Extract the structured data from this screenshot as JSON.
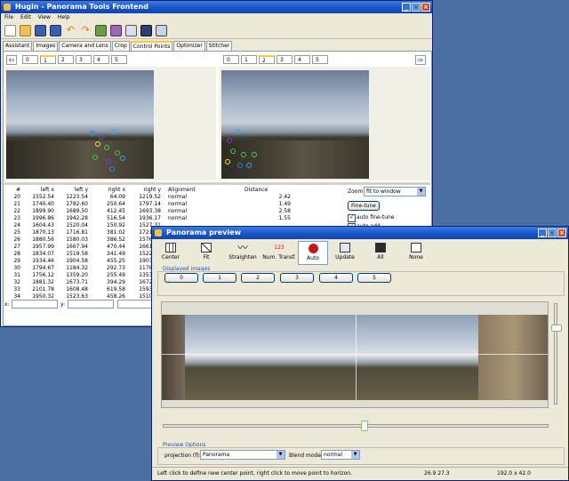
{
  "main_window": {
    "title": "Hugin - Panorama Tools Frontend",
    "menu": [
      "File",
      "Edit",
      "View",
      "Help"
    ],
    "tabs": [
      "Assistant",
      "Images",
      "Camera and Lens",
      "Crop",
      "Control Points",
      "Optimizer",
      "Stitcher"
    ],
    "active_tab": 4,
    "left_image_tabs": [
      "0",
      "1",
      "2",
      "3",
      "4",
      "5"
    ],
    "left_active_image": 1,
    "right_image_tabs": [
      "0",
      "1",
      "2",
      "3",
      "4",
      "5"
    ],
    "right_active_image": 2,
    "table": {
      "columns": [
        "#",
        "left x",
        "left y",
        "right x",
        "right y",
        "Alignment",
        "Distance"
      ],
      "rows": [
        [
          "20",
          "1552.54",
          "1223.54",
          "64.09",
          "1219.52",
          "normal",
          "2.42"
        ],
        [
          "21",
          "1740.40",
          "1782.60",
          "250.64",
          "1797.14",
          "normal",
          "1.49"
        ],
        [
          "22",
          "1899.90",
          "1689.50",
          "412.45",
          "1693.38",
          "normal",
          "2.58"
        ],
        [
          "23",
          "1996.86",
          "1942.28",
          "516.54",
          "1936.17",
          "normal",
          "1.55"
        ],
        [
          "24",
          "1604.43",
          "1520.04",
          "150.92",
          "1527.31",
          "",
          ""
        ],
        [
          "25",
          "1870.13",
          "1716.81",
          "381.02",
          "1721.72",
          "",
          ""
        ],
        [
          "26",
          "1880.56",
          "1580.03",
          "386.52",
          "1576.76",
          "",
          ""
        ],
        [
          "27",
          "1957.99",
          "1667.94",
          "470.44",
          "1661.54",
          "",
          ""
        ],
        [
          "28",
          "1834.07",
          "1519.58",
          "341.49",
          "1522.25",
          "",
          ""
        ],
        [
          "29",
          "1934.46",
          "1904.58",
          "455.25",
          "1903.96",
          "",
          ""
        ],
        [
          "30",
          "1794.67",
          "1184.32",
          "292.73",
          "1176.01",
          "",
          ""
        ],
        [
          "31",
          "1756.12",
          "1359.20",
          "255.49",
          "1353.62",
          "",
          ""
        ],
        [
          "32",
          "1881.32",
          "1673.71",
          "394.29",
          "1672.55",
          "",
          ""
        ],
        [
          "33",
          "2101.78",
          "1608.48",
          "619.58",
          "1593.37",
          "",
          ""
        ],
        [
          "34",
          "1950.32",
          "1523.63",
          "458.26",
          "1510.61",
          "",
          ""
        ]
      ]
    },
    "zoom_label": "Zoom:",
    "zoom_value": "fit to window",
    "fine_tune_label": "Fine-tune",
    "auto_fine_tune_label": "auto fine-tune",
    "auto_fine_tune_checked": true,
    "second_checkbox_label": "auto add",
    "coord_x_label": "x:",
    "coord_y_label": "y:"
  },
  "preview_window": {
    "title": "Panorama preview",
    "tools": [
      {
        "icon": "center-icon",
        "label": "Center"
      },
      {
        "icon": "fit-icon",
        "label": "Fit"
      },
      {
        "icon": "straighten-icon",
        "label": "Straighten"
      },
      {
        "icon": "num-transform-icon",
        "label": "Num. Transf."
      },
      {
        "icon": "auto-icon",
        "label": "Auto"
      },
      {
        "icon": "update-icon",
        "label": "Update"
      },
      {
        "icon": "all-icon",
        "label": "All"
      },
      {
        "icon": "none-icon",
        "label": "None"
      }
    ],
    "num_transf_badge": "123",
    "active_tool": 4,
    "displayed_images_label": "Displayed images",
    "image_buttons": [
      "0",
      "1",
      "2",
      "3",
      "4",
      "5"
    ],
    "preview_options_label": "Preview Options",
    "projection_label": "projection (f):",
    "projection_value": "Panorama",
    "blend_mode_label": "Blend mode:",
    "blend_mode_value": "normal",
    "status_text": "Left click to define new center point, right click to move point to horizon.",
    "status_coords": "26.9 27.3",
    "status_fov": "192.0 x 42.0",
    "horizontal_slider_value": 0.48,
    "vertical_slider_value": 0.18
  },
  "colors": {
    "titlebar": "#1753c6",
    "window_bg": "#ece9d8",
    "active_tab_accent": "#ffc83c",
    "control_points": [
      "#3aa4e8",
      "#3ccf3c",
      "#e8e83c",
      "#7a3ce0",
      "#3c7be0"
    ]
  }
}
